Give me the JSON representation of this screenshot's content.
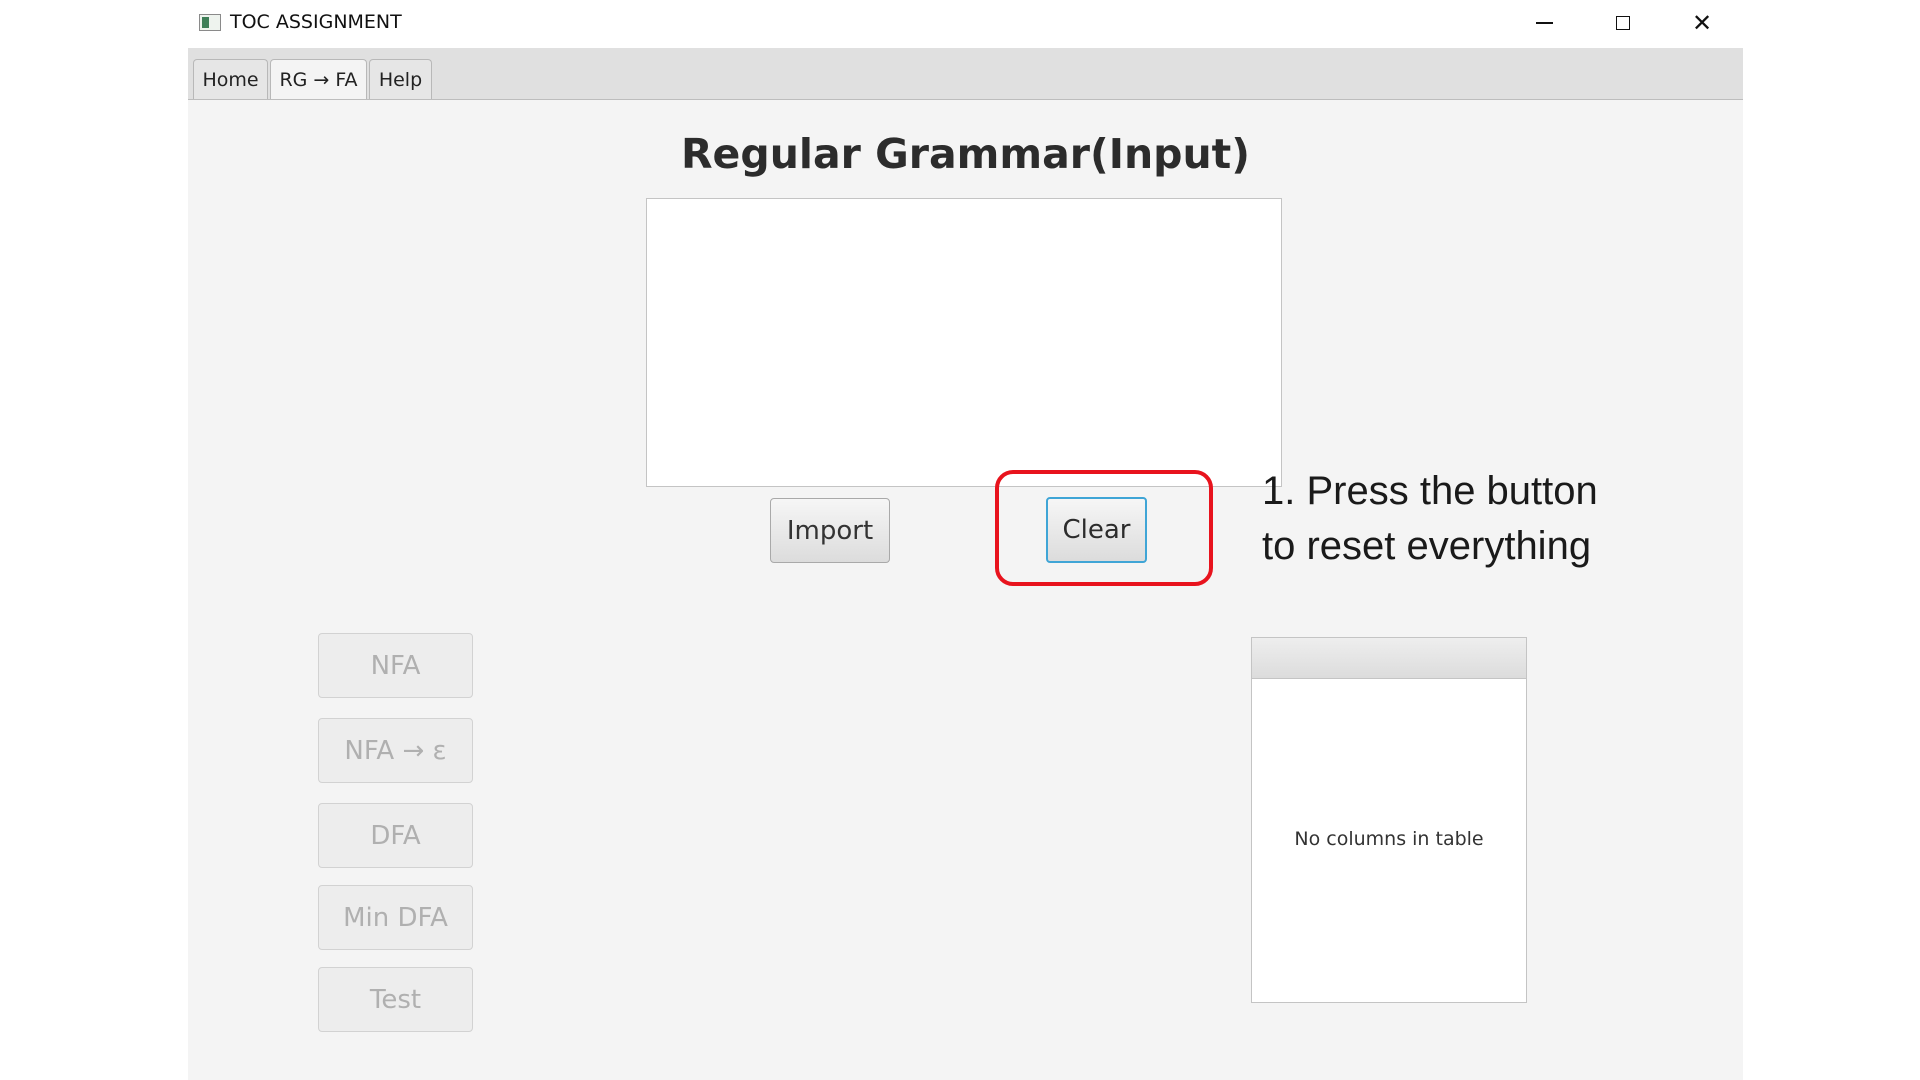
{
  "window": {
    "title": "TOC ASSIGNMENT",
    "icon": "app-icon",
    "controls": {
      "minimize_icon": "minimize-icon",
      "maximize_icon": "maximize-icon",
      "close_icon": "close-icon",
      "close_glyph": "✕"
    }
  },
  "tabs": [
    {
      "label": "Home",
      "selected": false
    },
    {
      "label": "RG → FA",
      "selected": true
    },
    {
      "label": "Help",
      "selected": false
    }
  ],
  "main": {
    "heading": "Regular Grammar(Input)",
    "grammar_input": {
      "value": "",
      "placeholder": ""
    },
    "import_label": "Import",
    "clear_label": "Clear"
  },
  "callout": {
    "line1": "1. Press the button",
    "line2": "to reset everything",
    "highlight_color": "#e8131d"
  },
  "side_buttons": {
    "nfa": "NFA",
    "nfa_epsilon": "NFA → ε",
    "dfa": "DFA",
    "min_dfa": "Min DFA",
    "test": "Test",
    "enabled": false
  },
  "table": {
    "placeholder": "No columns in table"
  }
}
